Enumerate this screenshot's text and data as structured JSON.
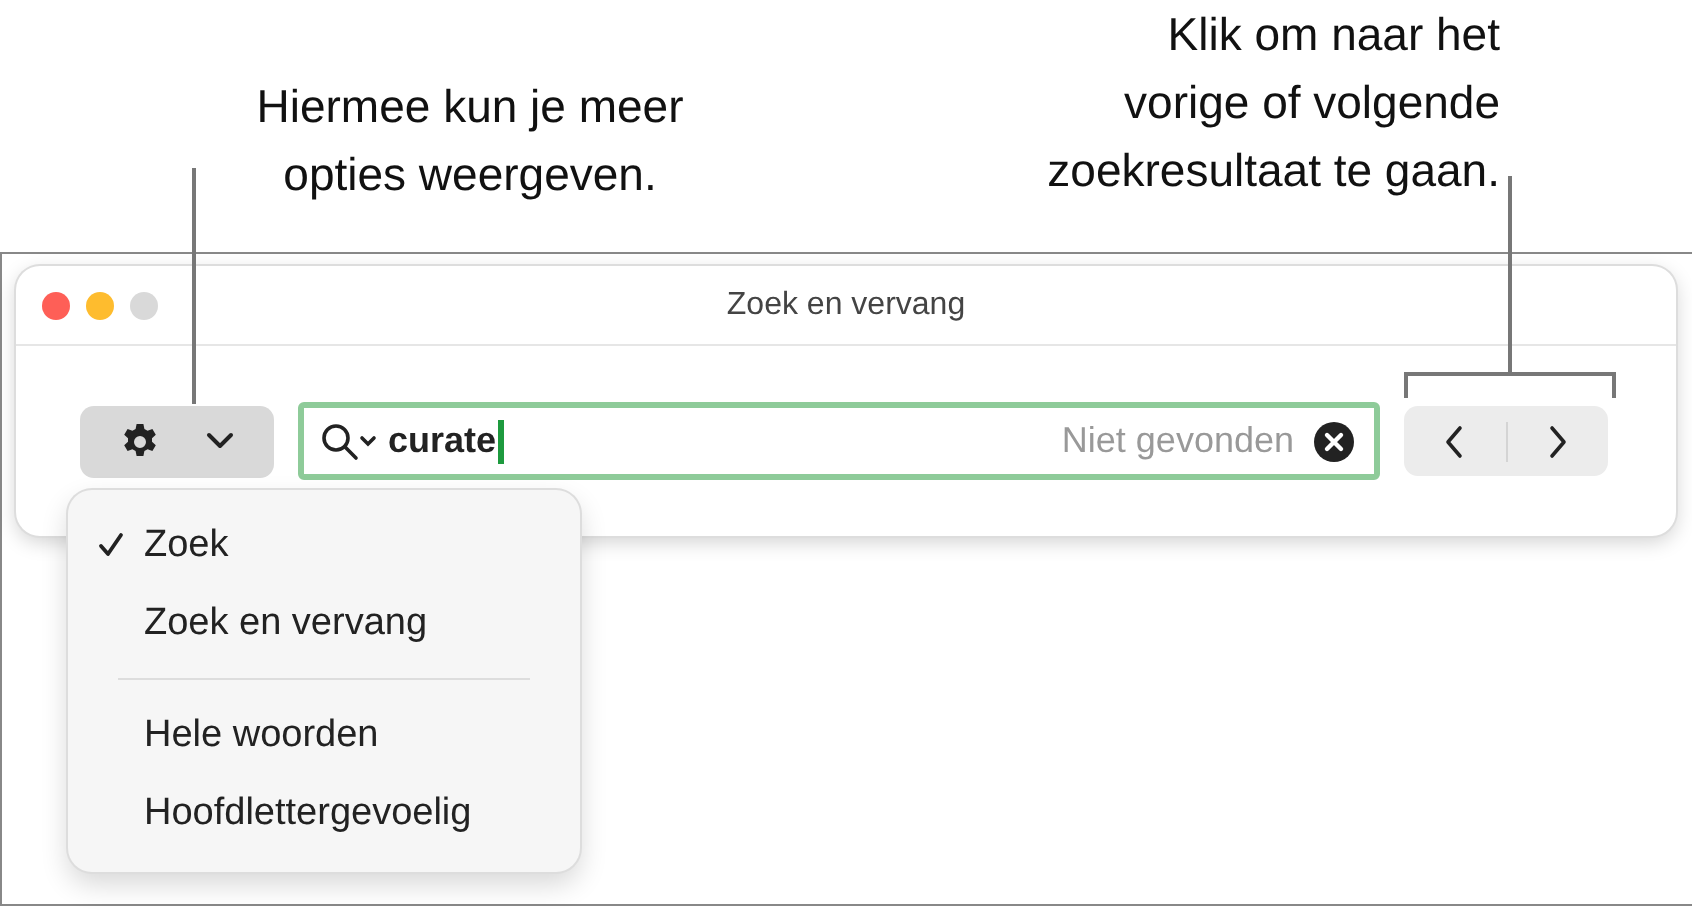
{
  "callouts": [
    {
      "text": "Hiermee kun je meer\nopties weergeven."
    },
    {
      "text": "Klik om naar het\nvorige of volgende\nzoekresultaat te gaan."
    }
  ],
  "window": {
    "title": "Zoek en vervang"
  },
  "search": {
    "value": "curate",
    "status": "Niet gevonden"
  },
  "menu": {
    "items": [
      {
        "kind": "item",
        "label": "Zoek",
        "checked": true
      },
      {
        "kind": "item",
        "label": "Zoek en vervang",
        "checked": false
      },
      {
        "kind": "separator"
      },
      {
        "kind": "item",
        "label": "Hele woorden",
        "checked": false
      },
      {
        "kind": "item",
        "label": "Hoofdlettergevoelig",
        "checked": false
      }
    ]
  }
}
